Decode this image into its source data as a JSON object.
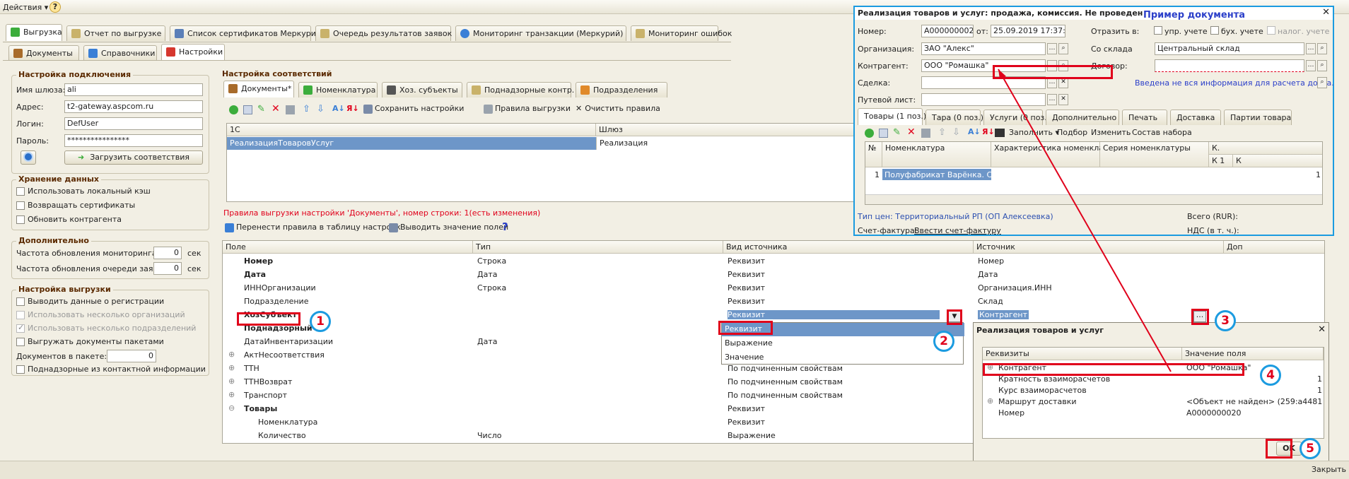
{
  "topbar": {
    "actions": "Действия ▾",
    "help": "?"
  },
  "main_tabs": [
    "Выгрузка",
    "Отчет по выгрузке",
    "Список сертификатов Меркурий",
    "Очередь результатов заявок",
    "Мониторинг транзакции (Меркурий)",
    "Мониторинг ошибок"
  ],
  "sub_tabs": [
    "Документы",
    "Справочники",
    "Настройки"
  ],
  "connection": {
    "title": "Настройка подключения",
    "gateway_label": "Имя шлюза:",
    "gateway": "ali",
    "address_label": "Адрес:",
    "address": "t2-gateway.aspcom.ru",
    "login_label": "Логин:",
    "login": "DefUser",
    "password_label": "Пароль:",
    "password": "****************",
    "load_button": "Загрузить соответствия"
  },
  "storage": {
    "title": "Хранение данных",
    "options": [
      "Использовать локальный кэш",
      "Возвращать сертификаты",
      "Обновить контрагента"
    ]
  },
  "additional": {
    "title": "Дополнительно",
    "monitor_label": "Частота обновления мониторинга:",
    "monitor_value": "0",
    "monitor_unit": "сек",
    "queue_label": "Частота обновления очереди заявок:",
    "queue_value": "0",
    "queue_unit": "сек"
  },
  "export": {
    "title": "Настройка выгрузки",
    "options": [
      "Выводить данные о регистрации",
      "Использовать несколько организаций",
      "Использовать несколько подразделений",
      "Выгружать документы пакетами"
    ],
    "docs_label": "Документов в пакете:",
    "docs_value": "0",
    "sub_option": "Поднадзорные из контактной информации"
  },
  "mapping": {
    "title": "Настройка соответствий",
    "tabs": [
      "Документы*",
      "Номенклатура",
      "Хоз. субъекты",
      "Поднадзорные контр.",
      "Подразделения"
    ],
    "toolbar": {
      "save": "Сохранить настройки",
      "rules": "Правила выгрузки",
      "clear": "Очистить правила"
    },
    "columns": [
      "1С",
      "Шлюз"
    ],
    "row": {
      "c1": "РеализацияТоваровУслуг",
      "c2": "Реализация"
    }
  },
  "rules_info": "Правила выгрузки настройки 'Документы', номер строки: 1(есть изменения)",
  "rules_toolbar": {
    "move": "Перенести правила в таблицу настроек",
    "show": "Выводить значение полей",
    "help": "?"
  },
  "fields": {
    "columns": [
      "Поле",
      "Тип",
      "Вид источника",
      "Источник",
      "Доп"
    ],
    "rows": [
      {
        "f": "Номер",
        "t": "Строка",
        "v": "Реквизит",
        "s": "Номер",
        "bold": true,
        "exp": ""
      },
      {
        "f": "Дата",
        "t": "Дата",
        "v": "Реквизит",
        "s": "Дата",
        "bold": true,
        "exp": ""
      },
      {
        "f": "ИННОрганизации",
        "t": "Строка",
        "v": "Реквизит",
        "s": "Организация.ИНН",
        "bold": false,
        "exp": ""
      },
      {
        "f": "Подразделение",
        "t": "",
        "v": "Реквизит",
        "s": "Склад",
        "bold": false,
        "exp": ""
      },
      {
        "f": "ХозСубъект",
        "t": "",
        "v": "Реквизит",
        "s": "Контрагент",
        "bold": true,
        "exp": ""
      },
      {
        "f": "Поднадзорный",
        "t": "",
        "v": "",
        "s": "",
        "bold": true,
        "exp": ""
      },
      {
        "f": "ДатаИнвентаризации",
        "t": "Дата",
        "v": "",
        "s": "",
        "bold": false,
        "exp": ""
      },
      {
        "f": "АктНесоответствия",
        "t": "",
        "v": "",
        "s": "",
        "bold": false,
        "exp": "⊕"
      },
      {
        "f": "ТТН",
        "t": "",
        "v": "По подчиненным свойствам",
        "s": "",
        "bold": false,
        "exp": "⊕"
      },
      {
        "f": "ТТНВозврат",
        "t": "",
        "v": "По подчиненным свойствам",
        "s": "",
        "bold": false,
        "exp": "⊕"
      },
      {
        "f": "Транспорт",
        "t": "",
        "v": "По подчиненным свойствам",
        "s": "",
        "bold": false,
        "exp": "⊕"
      },
      {
        "f": "Товары",
        "t": "",
        "v": "Реквизит",
        "s": "",
        "bold": true,
        "exp": "⊖"
      },
      {
        "f": "Номенклатура",
        "t": "",
        "v": "Реквизит",
        "s": "",
        "bold": false,
        "exp": ""
      },
      {
        "f": "Количество",
        "t": "Число",
        "v": "Выражение",
        "s": "",
        "bold": false,
        "exp": ""
      }
    ],
    "dropdown": [
      "Реквизит",
      "Выражение",
      "Значение"
    ]
  },
  "doc_window": {
    "title": "Реализация товаров и услуг: продажа, комиссия. Не проведен",
    "example": "Пример документа",
    "number_label": "Номер:",
    "number": "А0000000020",
    "from_label": "от:",
    "date": "25.09.2019 17:37:56",
    "reflect_label": "Отразить в:",
    "upr": "упр. учете",
    "buh": "бух. учете",
    "nal": "налог. учете",
    "org_label": "Организация:",
    "org": "ЗАО \"Алекс\"",
    "warehouse_label": "Со склада",
    "warehouse": "Центральный склад",
    "counterparty_label": "Контрагент:",
    "counterparty": "ООО \"Ромашка\"",
    "contract_label": "Договор:",
    "deal_label": "Сделка:",
    "waybill_label": "Путевой лист:",
    "warning": "Введена не вся информация для расчета долга.",
    "tabs": [
      "Товары (1 поз.)",
      "Тара (0 поз.)",
      "Услуги (0 поз.)",
      "Дополнительно",
      "Печать",
      "Доставка",
      "Партии товара"
    ],
    "toolbar": {
      "fill": "Заполнить ▾",
      "pick": "Подбор",
      "change": "Изменить",
      "set": "Состав набора"
    },
    "grid_cols": [
      "№",
      "Номенклатура",
      "Характеристика номенклатуры",
      "Серия номенклатуры",
      "К."
    ],
    "grid_sub": [
      "К 1",
      "К"
    ],
    "grid_row": {
      "n": "1",
      "name": "Полуфабрикат Варёнка. Сгущёнк...",
      "k": "1"
    },
    "price_type": "Тип цен: Территориальный РП (ОП Алексеевка)",
    "total_label": "Всего (RUR):",
    "invoice_label": "Счет-фактура:",
    "invoice_link": "Ввести счет-фактуру",
    "vat_label": "НДС (в т. ч.):"
  },
  "attr_window": {
    "title": "Реализация товаров и услуг",
    "cols": [
      "Реквизиты",
      "Значение поля"
    ],
    "rows": [
      {
        "k": "Контрагент",
        "v": "ООО \"Ромашка\"",
        "exp": "⊕"
      },
      {
        "k": "Кратность взаиморасчетов",
        "v": "1",
        "exp": ""
      },
      {
        "k": "Курс взаиморасчетов",
        "v": "1",
        "exp": ""
      },
      {
        "k": "Маршрут доставки",
        "v": "<Объект не найден> (259:a44818a...",
        "exp": "⊕"
      },
      {
        "k": "Номер",
        "v": "А0000000020",
        "exp": ""
      }
    ],
    "ok": "OK"
  },
  "close_label": "Закрыть",
  "markers": [
    "1",
    "2",
    "3",
    "4",
    "5"
  ]
}
